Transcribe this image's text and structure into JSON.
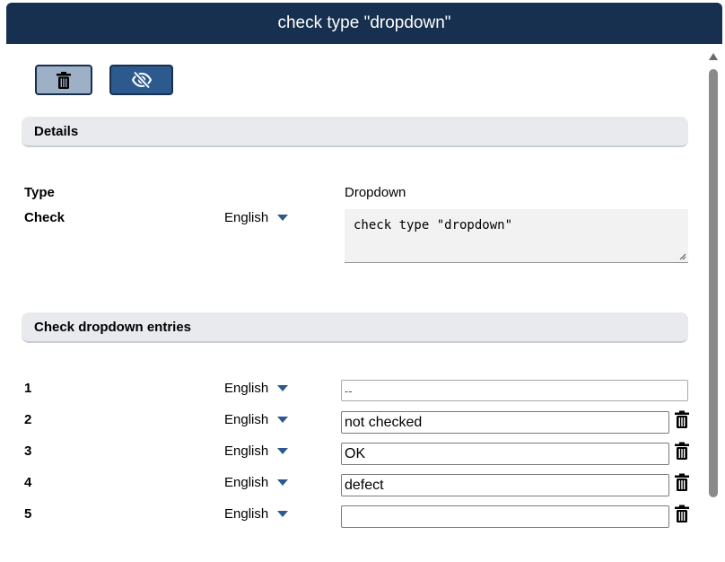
{
  "window": {
    "title": "check type \"dropdown\""
  },
  "toolbar": {
    "delete_icon": "trash-icon",
    "hide_icon": "eye-slash-icon"
  },
  "details": {
    "heading": "Details",
    "type_label": "Type",
    "type_value": "Dropdown",
    "check_label": "Check",
    "check_language": "English",
    "check_text": "check type \"dropdown\""
  },
  "entries": {
    "heading": "Check dropdown entries",
    "rows": [
      {
        "index": "1",
        "language": "English",
        "value": "--"
      },
      {
        "index": "2",
        "language": "English",
        "value": "not checked"
      },
      {
        "index": "3",
        "language": "English",
        "value": "OK"
      },
      {
        "index": "4",
        "language": "English",
        "value": "defect"
      },
      {
        "index": "5",
        "language": "English",
        "value": ""
      }
    ]
  },
  "colors": {
    "titlebar": "#17304f",
    "accent": "#2c5a8e",
    "section_bg": "#e8eaed"
  }
}
